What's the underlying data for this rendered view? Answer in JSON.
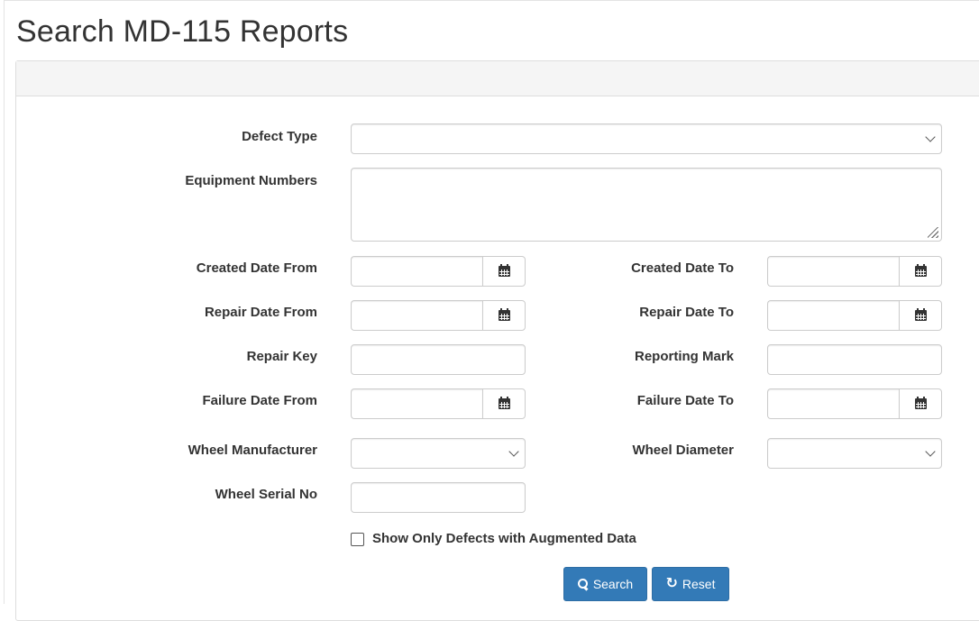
{
  "page": {
    "title": "Search MD-115 Reports"
  },
  "form": {
    "defect_type": {
      "label": "Defect Type",
      "value": ""
    },
    "equipment_numbers": {
      "label": "Equipment Numbers",
      "value": ""
    },
    "created_date_from": {
      "label": "Created Date From",
      "value": ""
    },
    "created_date_to": {
      "label": "Created Date To",
      "value": ""
    },
    "repair_date_from": {
      "label": "Repair Date From",
      "value": ""
    },
    "repair_date_to": {
      "label": "Repair Date To",
      "value": ""
    },
    "repair_key": {
      "label": "Repair Key",
      "value": ""
    },
    "reporting_mark": {
      "label": "Reporting Mark",
      "value": ""
    },
    "failure_date_from": {
      "label": "Failure Date From",
      "value": ""
    },
    "failure_date_to": {
      "label": "Failure Date To",
      "value": ""
    },
    "wheel_manufacturer": {
      "label": "Wheel Manufacturer",
      "value": ""
    },
    "wheel_diameter": {
      "label": "Wheel Diameter",
      "value": ""
    },
    "wheel_serial_no": {
      "label": "Wheel Serial No",
      "value": ""
    },
    "augmented_only": {
      "label": "Show Only Defects with Augmented Data",
      "checked": false
    }
  },
  "actions": {
    "search_label": "Search",
    "reset_label": "Reset",
    "search_icon": "search-icon",
    "reset_icon": "refresh-icon",
    "button_color": "#337ab7"
  }
}
